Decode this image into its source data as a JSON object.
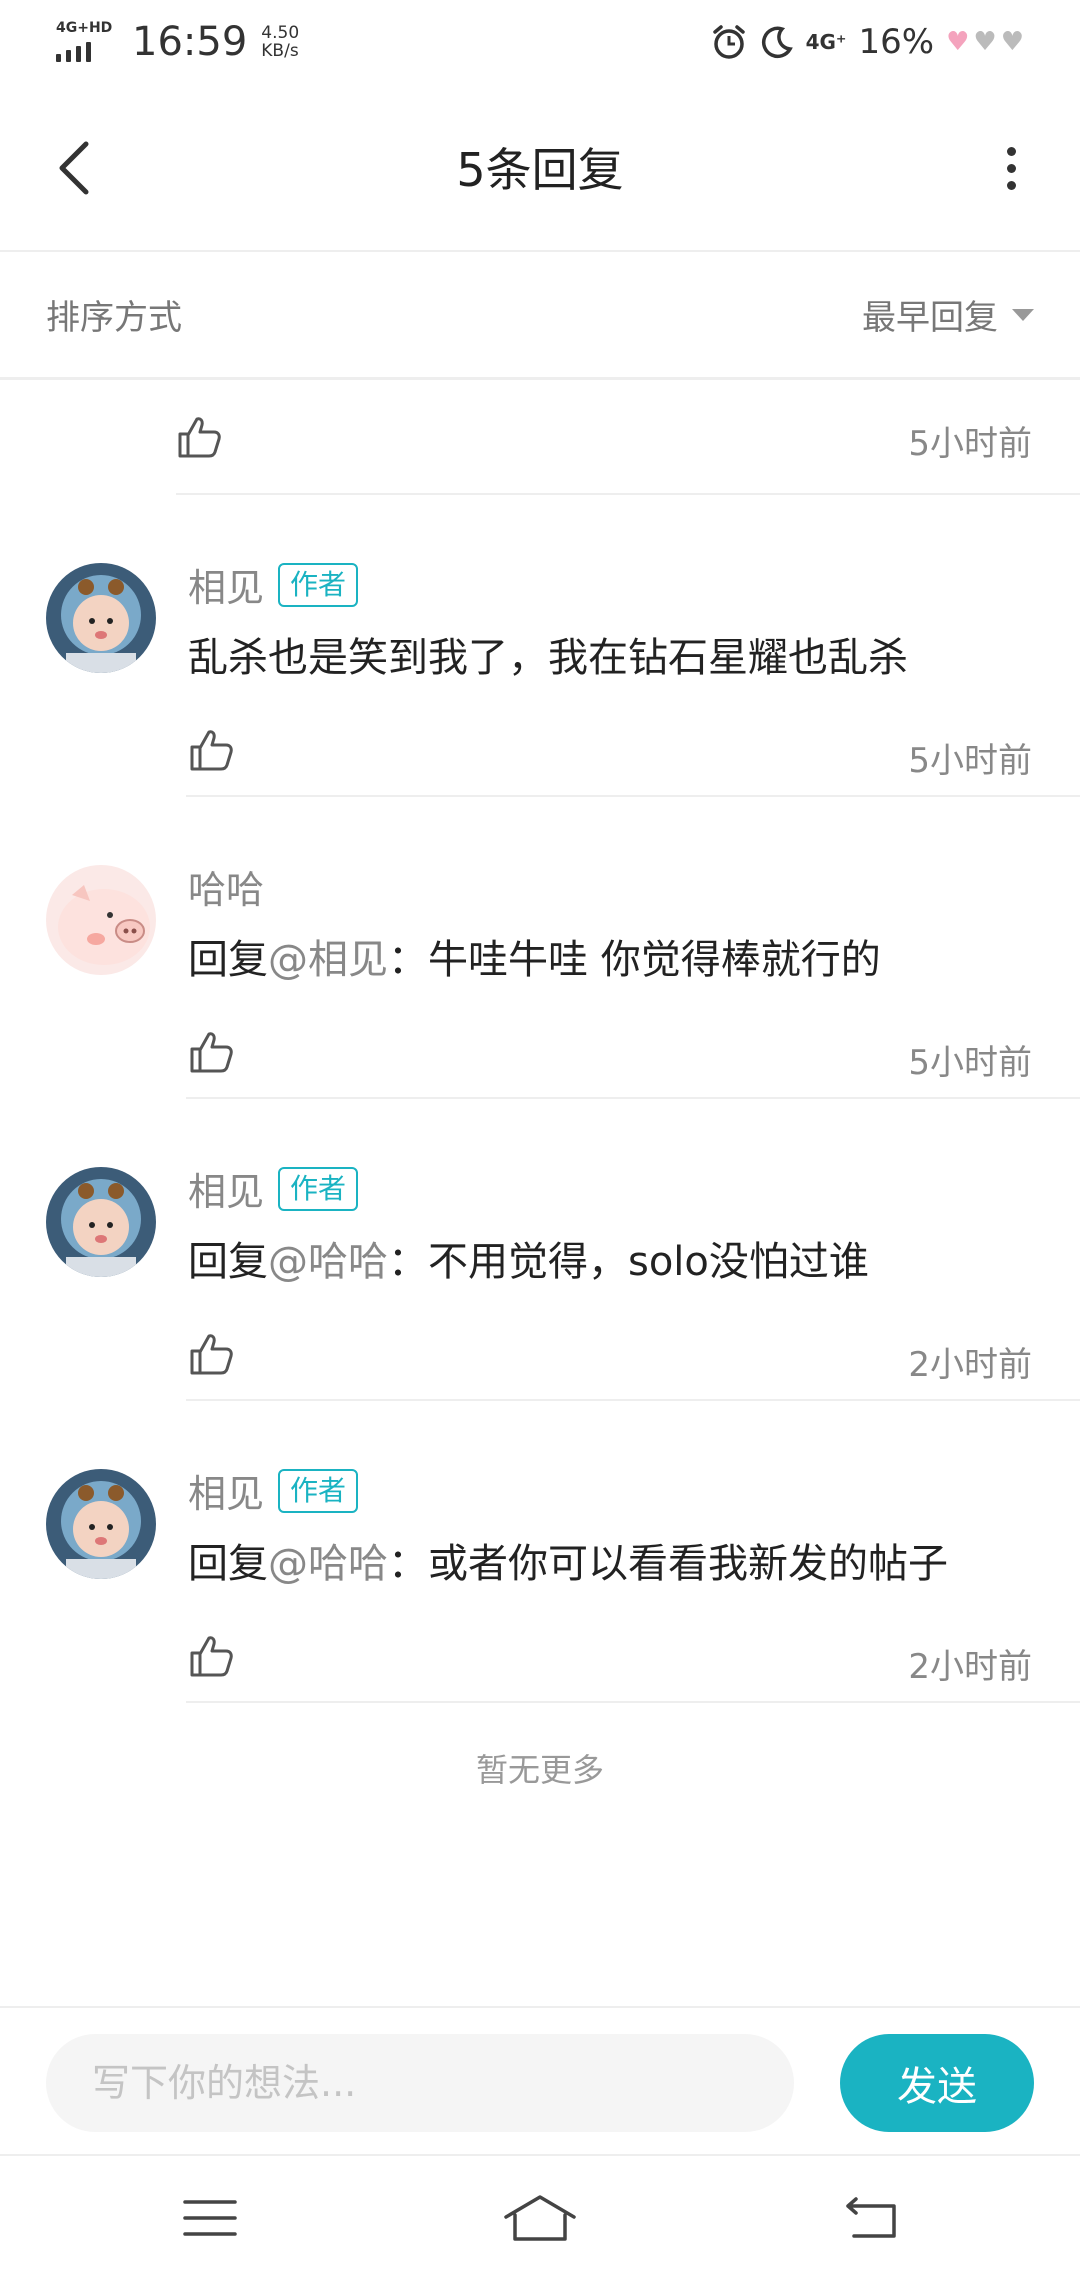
{
  "status_bar": {
    "network_label": "4G+HD",
    "time": "16:59",
    "speed_value": "4.50",
    "speed_unit": "KB/s",
    "network_right": "4G⁺",
    "battery": "16%"
  },
  "header": {
    "title": "5条回复"
  },
  "sort": {
    "label": "排序方式",
    "selected": "最早回复"
  },
  "partial_reply": {
    "time": "5小时前"
  },
  "replies": [
    {
      "name": "相见",
      "badge": "作者",
      "prefix": "",
      "mention": "",
      "text": "乱杀也是笑到我了，我在钻石星耀也乱杀",
      "time": "5小时前",
      "avatar": "baby-avatar"
    },
    {
      "name": "哈哈",
      "badge": "",
      "prefix": "回复",
      "mention": "@相见",
      "text": "：牛哇牛哇 你觉得棒就行的",
      "time": "5小时前",
      "avatar": "pig-avatar"
    },
    {
      "name": "相见",
      "badge": "作者",
      "prefix": "回复",
      "mention": "@哈哈",
      "text": "：不用觉得，solo没怕过谁",
      "time": "2小时前",
      "avatar": "baby-avatar"
    },
    {
      "name": "相见",
      "badge": "作者",
      "prefix": "回复",
      "mention": "@哈哈",
      "text": "：或者你可以看看我新发的帖子",
      "time": "2小时前",
      "avatar": "baby-avatar"
    }
  ],
  "footer_note": "暂无更多",
  "composer": {
    "placeholder": "写下你的想法...",
    "send_label": "发送"
  },
  "colors": {
    "accent": "#1ab3c2",
    "muted_text": "#888888",
    "divider": "#eeeeee"
  }
}
